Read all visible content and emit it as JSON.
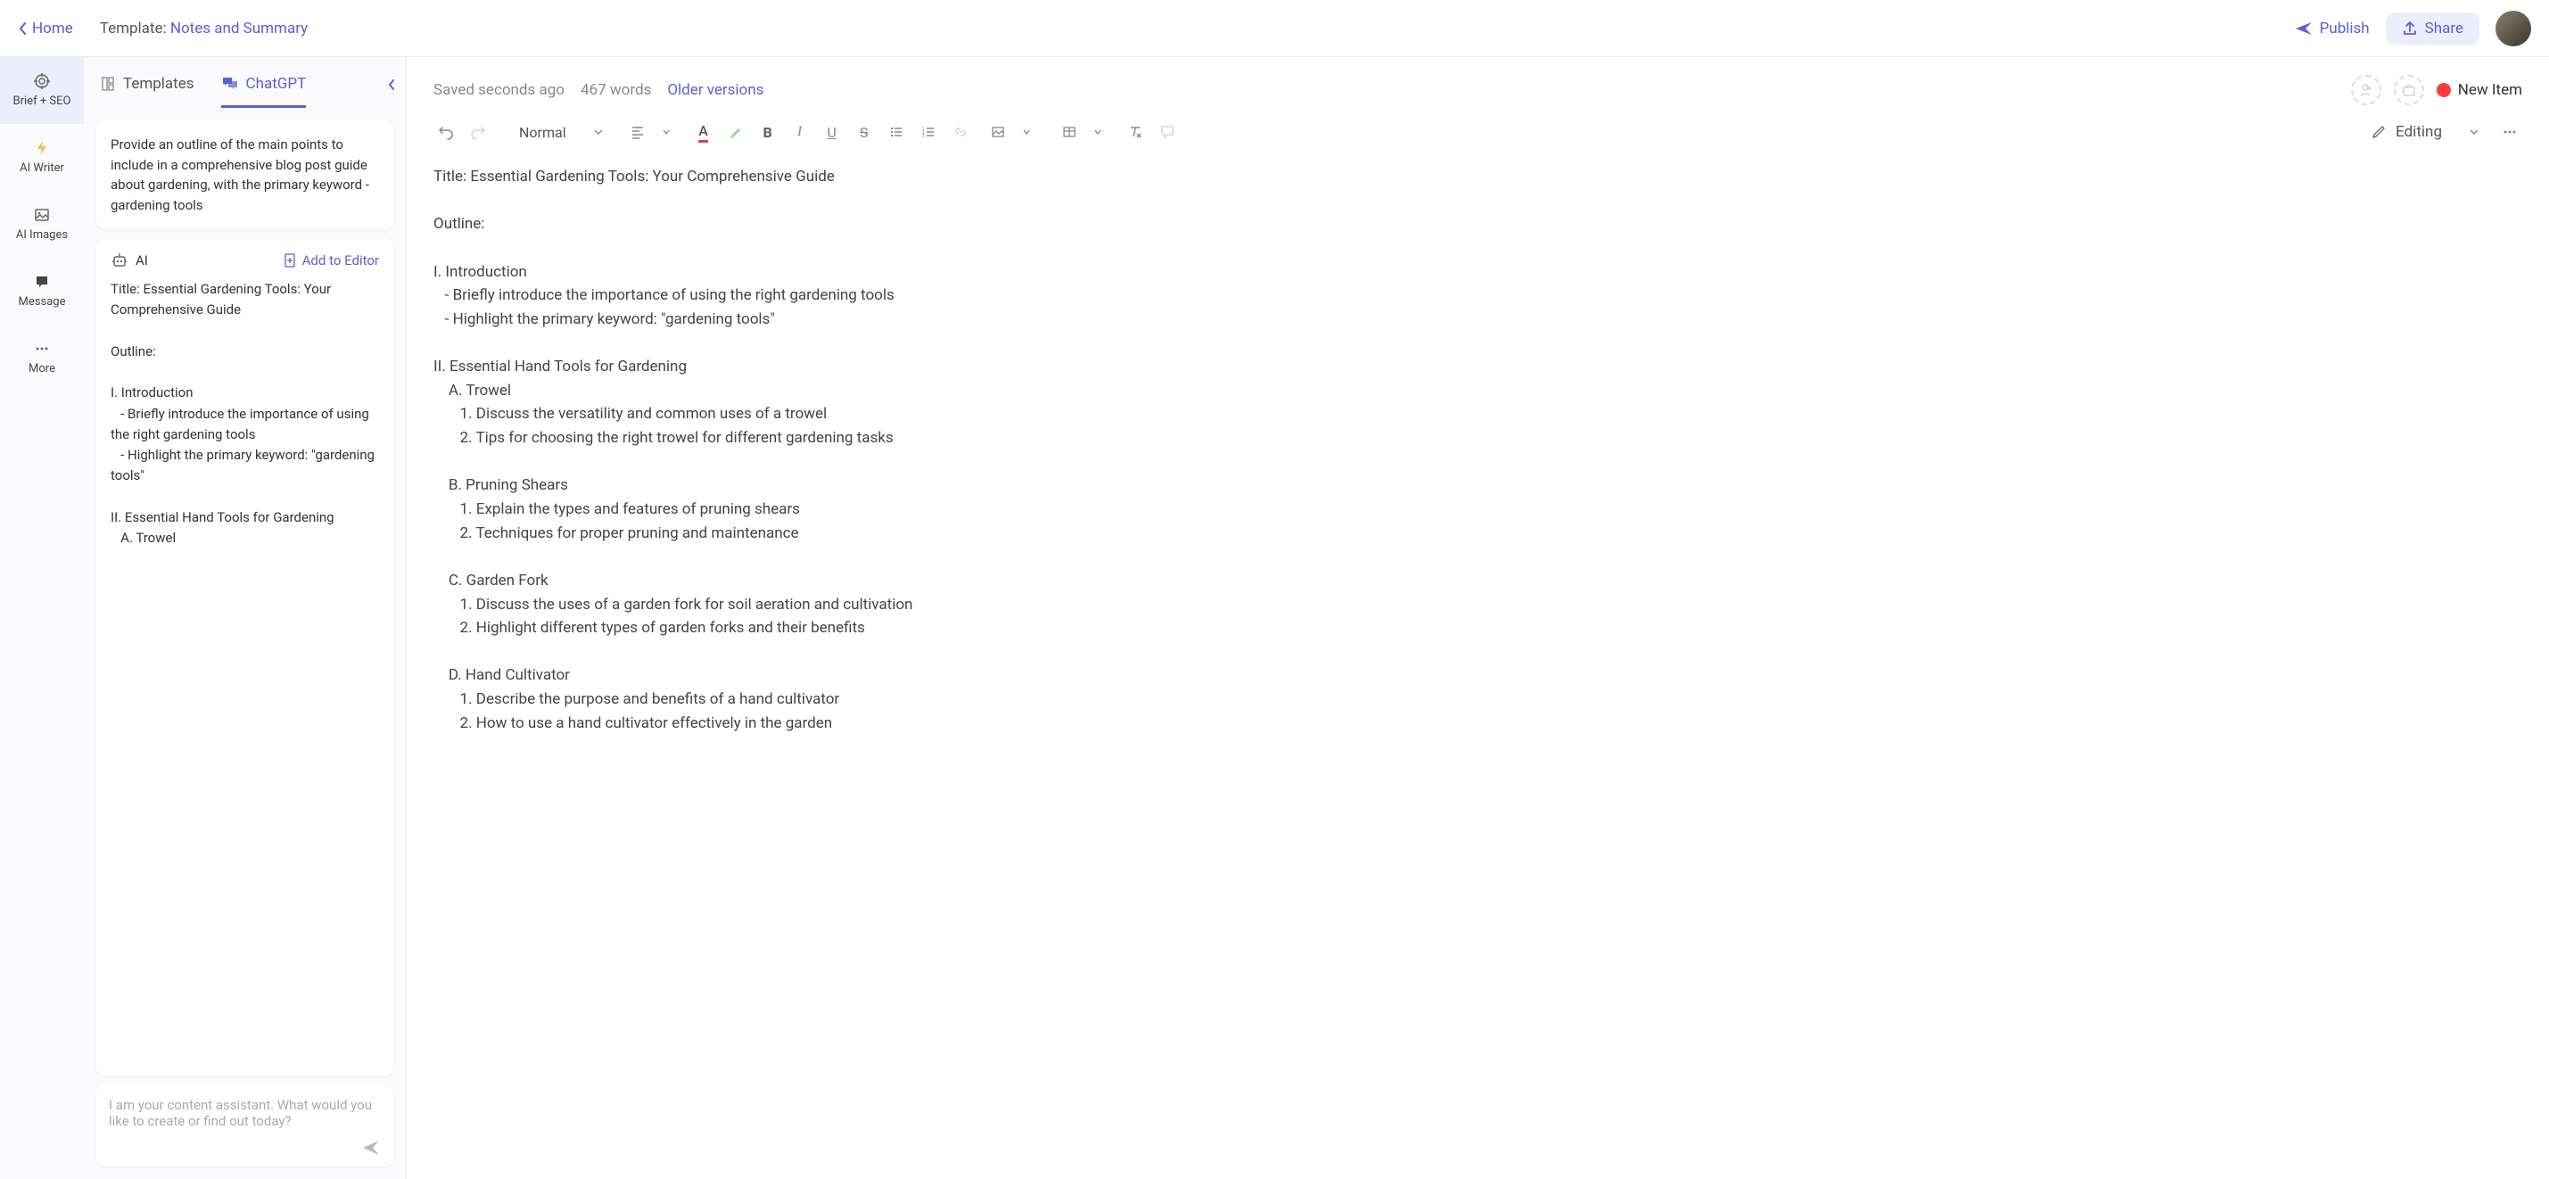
{
  "header": {
    "home": "Home",
    "template_label": "Template:",
    "template_name": "Notes and Summary",
    "publish": "Publish",
    "share": "Share"
  },
  "rail": {
    "brief": "Brief + SEO",
    "writer": "AI Writer",
    "images": "AI Images",
    "message": "Message",
    "more": "More"
  },
  "panel": {
    "tab_templates": "Templates",
    "tab_chatgpt": "ChatGPT",
    "prompt": "Provide an outline of the main points to include in a comprehensive blog post guide about gardening, with the primary keyword -gardening tools",
    "ai_label": "AI",
    "add_to_editor": "Add to Editor",
    "response": "Title: Essential Gardening Tools: Your Comprehensive Guide\n\nOutline:\n\nI. Introduction\n   - Briefly introduce the importance of using the right gardening tools\n   - Highlight the primary keyword: \"gardening tools\"\n\nII. Essential Hand Tools for Gardening\n   A. Trowel",
    "input_placeholder": "I am your content assistant. What would you like to create or find out today?"
  },
  "editor_top": {
    "saved": "Saved seconds ago",
    "words": "467 words",
    "versions": "Older versions",
    "new_item": "New Item"
  },
  "toolbar": {
    "style": "Normal",
    "editing": "Editing"
  },
  "document": {
    "lines": [
      "Title: Essential Gardening Tools: Your Comprehensive Guide",
      "",
      "Outline:",
      "",
      "I. Introduction",
      "   - Briefly introduce the importance of using the right gardening tools",
      "   - Highlight the primary keyword: \"gardening tools\"",
      "",
      "II. Essential Hand Tools for Gardening",
      "    A. Trowel",
      "       1. Discuss the versatility and common uses of a trowel",
      "       2. Tips for choosing the right trowel for different gardening tasks",
      "",
      "    B. Pruning Shears",
      "       1. Explain the types and features of pruning shears",
      "       2. Techniques for proper pruning and maintenance",
      "",
      "    C. Garden Fork",
      "       1. Discuss the uses of a garden fork for soil aeration and cultivation",
      "       2. Highlight different types of garden forks and their benefits",
      "",
      "    D. Hand Cultivator",
      "       1. Describe the purpose and benefits of a hand cultivator",
      "       2. How to use a hand cultivator effectively in the garden"
    ]
  }
}
